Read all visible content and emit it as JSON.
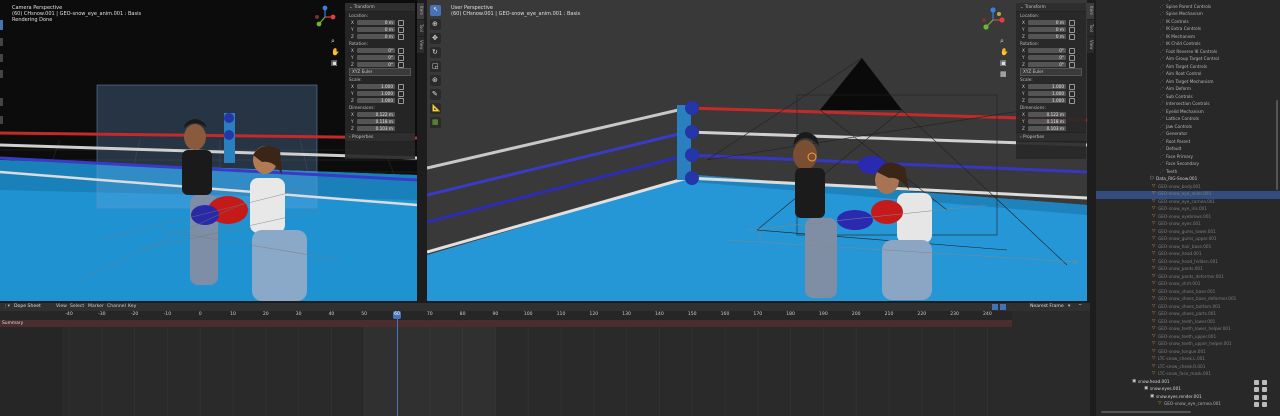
{
  "viewport_left": {
    "title": "Camera Perspective",
    "subtitle": "(60) CHsnow.001 | GEO-snow_eye_anim.001 : Basis",
    "status": "Rendering Done"
  },
  "viewport_right": {
    "title": "User Perspective",
    "subtitle": "(60) CHsnow.001 | GEO-snow_eye_anim.001 : Basis"
  },
  "npanel_left": {
    "transform": "Transform",
    "location": "Location:",
    "loc": [
      {
        "axis": "X",
        "value": "0 m"
      },
      {
        "axis": "Y",
        "value": "0 m"
      },
      {
        "axis": "Z",
        "value": "0 m"
      }
    ],
    "rotation": "Rotation:",
    "rot": [
      {
        "axis": "X",
        "value": "0°"
      },
      {
        "axis": "Y",
        "value": "0°"
      },
      {
        "axis": "Z",
        "value": "0°"
      }
    ],
    "euler": "XYZ Euler",
    "scale": "Scale:",
    "scl": [
      {
        "axis": "X",
        "value": "1.000"
      },
      {
        "axis": "Y",
        "value": "1.000"
      },
      {
        "axis": "Z",
        "value": "1.000"
      }
    ],
    "dimensions": "Dimensions:",
    "dim": [
      {
        "axis": "X",
        "value": "0.122 m"
      },
      {
        "axis": "Y",
        "value": "0.118 m"
      },
      {
        "axis": "Z",
        "value": "0.103 m"
      }
    ],
    "properties": "Properties"
  },
  "npanel_right": {
    "transform": "Transform",
    "location": "Location:",
    "loc": [
      {
        "axis": "X",
        "value": "0 m"
      },
      {
        "axis": "Y",
        "value": "0 m"
      },
      {
        "axis": "Z",
        "value": "0 m"
      }
    ],
    "rotation": "Rotation:",
    "rot": [
      {
        "axis": "X",
        "value": "0°"
      },
      {
        "axis": "Y",
        "value": "0°"
      },
      {
        "axis": "Z",
        "value": "0°"
      }
    ],
    "euler": "XYZ Euler",
    "scale": "Scale:",
    "scl": [
      {
        "axis": "X",
        "value": "1.000"
      },
      {
        "axis": "Y",
        "value": "1.000"
      },
      {
        "axis": "Z",
        "value": "1.000"
      }
    ],
    "dimensions": "Dimensions:",
    "dim": [
      {
        "axis": "X",
        "value": "0.122 m"
      },
      {
        "axis": "Y",
        "value": "0.118 m"
      },
      {
        "axis": "Z",
        "value": "0.103 m"
      }
    ],
    "properties": "Properties"
  },
  "sidebar_tabs": [
    "Item",
    "Tool",
    "View"
  ],
  "dopesheet": {
    "editor": "Dope Sheet",
    "menus": [
      "View",
      "Select",
      "Marker",
      "Channel",
      "Key"
    ],
    "interpolation": "Nearest Frame",
    "summary": "Summary",
    "current_frame": "60",
    "ticks": [
      "-40",
      "-30",
      "-20",
      "-10",
      "0",
      "10",
      "20",
      "30",
      "40",
      "50",
      "60",
      "70",
      "80",
      "90",
      "100",
      "110",
      "120",
      "130",
      "140",
      "150",
      "160",
      "170",
      "180",
      "190",
      "200",
      "210",
      "220",
      "230",
      "240"
    ]
  },
  "outliner": {
    "controls": [
      "Spine Main Controls",
      "Spine Parent Controls",
      "Spine Mechanism",
      "IK Controls",
      "IK Extra Controls",
      "IK Mechanism",
      "IK Child Controls",
      "Foot Reverse IK Controls",
      "Aim Group Target Control",
      "Aim Target Controls",
      "Aim Root Control",
      "Aim Target Mechanism",
      "Aim Deform",
      "Sub Controls",
      "Intersection Controls",
      "Eyelid Mechanism",
      "Lattice Controls",
      "Jaw Controls",
      "Generator",
      "Root Parent",
      "Default",
      "Face Primary",
      "Face Secondary",
      "Teeth"
    ],
    "collection": "Data_RIG-Snow.001",
    "objects": [
      "GEO-snow_body.001",
      "GEO-snow_eye_anim.001",
      "GEO-snow_eye_cornea.001",
      "GEO-snow_eye_iris.001",
      "GEO-snow_eyebrows.001",
      "GEO-snow_eyes.001",
      "GEO-snow_gums_lower.001",
      "GEO-snow_gums_upper.001",
      "GEO-snow_hair_base.001",
      "GEO-snow_head.001",
      "GEO-snow_head_hidden.001",
      "GEO-snow_pants.001",
      "GEO-snow_pants_deformer.001",
      "GEO-snow_shirt.001",
      "GEO-snow_shoes_base.001",
      "GEO-snow_shoes_base_deformer.001",
      "GEO-snow_shoes_bottom.001",
      "GEO-snow_shoes_parts.001",
      "GEO-snow_teeth_lower.001",
      "GEO-snow_teeth_lower_helper.001",
      "GEO-snow_teeth_upper.001",
      "GEO-snow_teeth_upper_helper.001",
      "GEO-snow_tongue.001",
      "LTC-snow_cheek.L.001",
      "LTC-snow_cheek.R.001",
      "LTC-snow_face_mask.001"
    ],
    "bottom": [
      "snow.head.001",
      "snow.eyes.001",
      "snow.eyes.render.001",
      "GEO-snow_eye_cornea.001"
    ]
  },
  "colors": {
    "accent": "#4772b3",
    "active_row": "#334d80",
    "playhead": "#4772b3",
    "ring_blue": "#1f8fd0"
  }
}
